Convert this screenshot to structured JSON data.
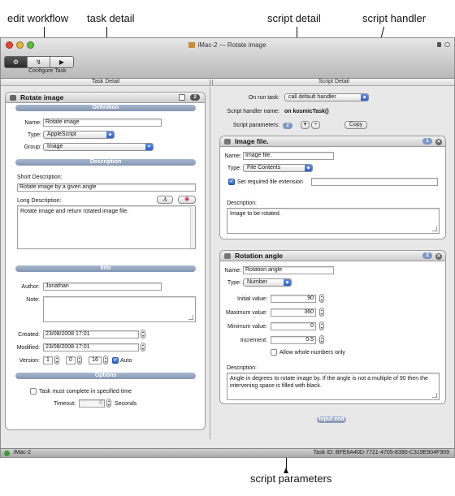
{
  "callouts": {
    "edit_workflow": "edit workflow",
    "task_detail": "task detail",
    "script_detail": "script detail",
    "script_handler": "script handler",
    "script_parameters": "script parameters"
  },
  "window": {
    "title": "iMac-2 — Rotate image",
    "configure_label": "Configure Task",
    "toolbar_segments": [
      {
        "icon": "gear-icon",
        "glyph": "⚙",
        "active": true
      },
      {
        "icon": "task-icon",
        "glyph": "↯",
        "active": false
      },
      {
        "icon": "play-icon",
        "glyph": "▶",
        "active": false
      }
    ],
    "pane_headers": {
      "left": "Task Detail",
      "right": "Script Detail"
    }
  },
  "task": {
    "title": "Rotate image",
    "badge": "2",
    "definition_header": "Definition",
    "name_label": "Name:",
    "name_value": "Rotate image",
    "type_label": "Type:",
    "type_value": "AppleScript",
    "group_label": "Group:",
    "group_value": "Image",
    "description_header": "Description",
    "short_desc_label": "Short Description:",
    "short_desc_value": "Rotate image by a given angle",
    "long_desc_label": "Long Description:",
    "long_desc_value": "Rotate image and return rotated image file.",
    "info_header": "Info",
    "author_label": "Author:",
    "author_value": "Jonathan",
    "note_label": "Note:",
    "created_label": "Created:",
    "created_value": "23/08/2008 17:01",
    "modified_label": "Modified:",
    "modified_value": "23/08/2008 17:01",
    "version_label": "Version:",
    "version_major": "1",
    "version_minor": "0",
    "version_build": "16",
    "auto_label": "Auto",
    "options_header": "Options",
    "must_complete_label": "Task must complete in specified time",
    "timeout_label": "Timeout:",
    "timeout_value": "0",
    "seconds_label": "Seconds"
  },
  "script": {
    "on_run_label": "On run task:",
    "on_run_value": "call default handler",
    "handler_name_label": "Script handler name:",
    "handler_name_value": "on kosmicTask()",
    "params_label": "Script parameters:",
    "params_count": "2",
    "add_label": "+",
    "remove_label": "−",
    "copy_label": "Copy",
    "input_end_label": "Input end",
    "params": [
      {
        "title": "Image file.",
        "index": "1",
        "name_label": "Name:",
        "name_value": "Image file.",
        "type_label": "Type:",
        "type_value": "File Contents",
        "set_ext_label": "Set required file extension",
        "desc_label": "Description:",
        "desc_value": "Image to be rotated."
      },
      {
        "title": "Rotation angle",
        "index": "2",
        "name_label": "Name:",
        "name_value": "Rotation angle",
        "type_label": "Type:",
        "type_value": "Number",
        "initial_label": "Initial value:",
        "initial_value": "90",
        "max_label": "Maximum value:",
        "max_value": "360",
        "min_label": "Minimum value:",
        "min_value": "0",
        "increment_label": "Increment:",
        "increment_value": "0.5",
        "whole_label": "Allow whole numbers only",
        "desc_label": "Description:",
        "desc_value": "Angle in degrees to rotate image by. If the angle is not a multiple of 90 then the intervening space is filled with black."
      }
    ]
  },
  "status": {
    "left": "iMac-2",
    "right": "Task ID: BFE6A40D-7721-4705-8390-C319E904F909"
  }
}
